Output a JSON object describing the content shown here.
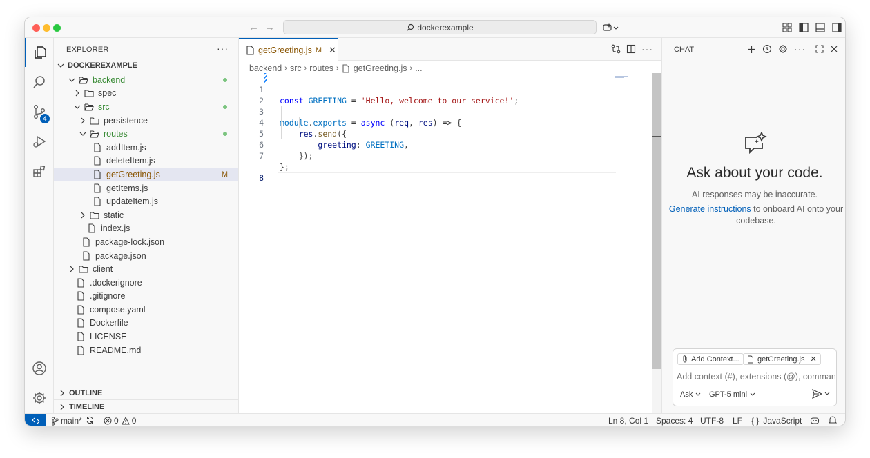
{
  "titlebar": {
    "search_text": "dockerexample"
  },
  "activity": {
    "scm_badge": "4"
  },
  "explorer": {
    "header": "EXPLORER",
    "more": "···",
    "root": "DOCKEREXAMPLE",
    "items": [
      {
        "label": "backend",
        "type": "folder-open",
        "depth": 1,
        "status": "dot"
      },
      {
        "label": "spec",
        "type": "folder",
        "depth": 2
      },
      {
        "label": "src",
        "type": "folder-open",
        "depth": 2,
        "status": "dot"
      },
      {
        "label": "persistence",
        "type": "folder",
        "depth": 3
      },
      {
        "label": "routes",
        "type": "folder-open",
        "depth": 3,
        "status": "dot"
      },
      {
        "label": "addItem.js",
        "type": "file",
        "depth": 4
      },
      {
        "label": "deleteItem.js",
        "type": "file",
        "depth": 4
      },
      {
        "label": "getGreeting.js",
        "type": "file",
        "depth": 4,
        "status": "M",
        "selected": true
      },
      {
        "label": "getItems.js",
        "type": "file",
        "depth": 4
      },
      {
        "label": "updateItem.js",
        "type": "file",
        "depth": 4
      },
      {
        "label": "static",
        "type": "folder",
        "depth": 3
      },
      {
        "label": "index.js",
        "type": "file",
        "depth": 3
      },
      {
        "label": "package-lock.json",
        "type": "file",
        "depth": 2
      },
      {
        "label": "package.json",
        "type": "file",
        "depth": 2
      },
      {
        "label": "client",
        "type": "folder",
        "depth": 1
      },
      {
        "label": ".dockerignore",
        "type": "file",
        "depth": 1
      },
      {
        "label": ".gitignore",
        "type": "file",
        "depth": 1
      },
      {
        "label": "compose.yaml",
        "type": "file",
        "depth": 1
      },
      {
        "label": "Dockerfile",
        "type": "file",
        "depth": 1
      },
      {
        "label": "LICENSE",
        "type": "file",
        "depth": 1
      },
      {
        "label": "README.md",
        "type": "file",
        "depth": 1
      }
    ],
    "outline": "OUTLINE",
    "timeline": "TIMELINE"
  },
  "editor": {
    "tab_label": "getGreeting.js",
    "tab_status": "M",
    "tab_close": "✕",
    "more": "···",
    "breadcrumb": [
      "backend",
      "src",
      "routes",
      "getGreeting.js",
      "..."
    ],
    "line_numbers": [
      "1",
      "2",
      "3",
      "4",
      "5",
      "6",
      "7",
      "8"
    ],
    "code": {
      "l1_kw": "const",
      "l1_var": "GREETING",
      "l1_eq": " = ",
      "l1_str": "'Hello, welcome to our service!'",
      "l1_end": ";",
      "l3_obj": "module",
      "l3_dot": ".",
      "l3_prop": "exports",
      "l3_eq": " = ",
      "l3_async": "async",
      "l3_open": " (",
      "l3_p1": "req",
      "l3_comma": ", ",
      "l3_p2": "res",
      "l3_arrow": ") => {",
      "l4_obj": "    res",
      "l4_dot": ".",
      "l4_fn": "send",
      "l4_rest": "({",
      "l5_prop": "        greeting",
      "l5_colon": ": ",
      "l5_var": "GREETING",
      "l5_end": ",",
      "l6": "    });",
      "l7": "};"
    }
  },
  "chat": {
    "title": "CHAT",
    "more": "···",
    "heading": "Ask about your code.",
    "subtitle": "AI responses may be inaccurate.",
    "gen_link": "Generate instructions",
    "gen_rest": " to onboard AI onto your codebase.",
    "add_context": "Add Context...",
    "context_file": "getGreeting.js",
    "context_close": "✕",
    "input_placeholder": "Add context (#), extensions (@), commands",
    "mode": "Ask",
    "model": "GPT-5 mini"
  },
  "statusbar": {
    "branch": "main*",
    "errors": "0",
    "warnings": "0",
    "position": "Ln 8, Col 1",
    "spaces": "Spaces: 4",
    "encoding": "UTF-8",
    "eol": "LF",
    "language": "JavaScript",
    "language_icon": "{ }"
  },
  "colors": {
    "accent": "#005fb8",
    "modified": "#895503",
    "added": "#388a34"
  }
}
